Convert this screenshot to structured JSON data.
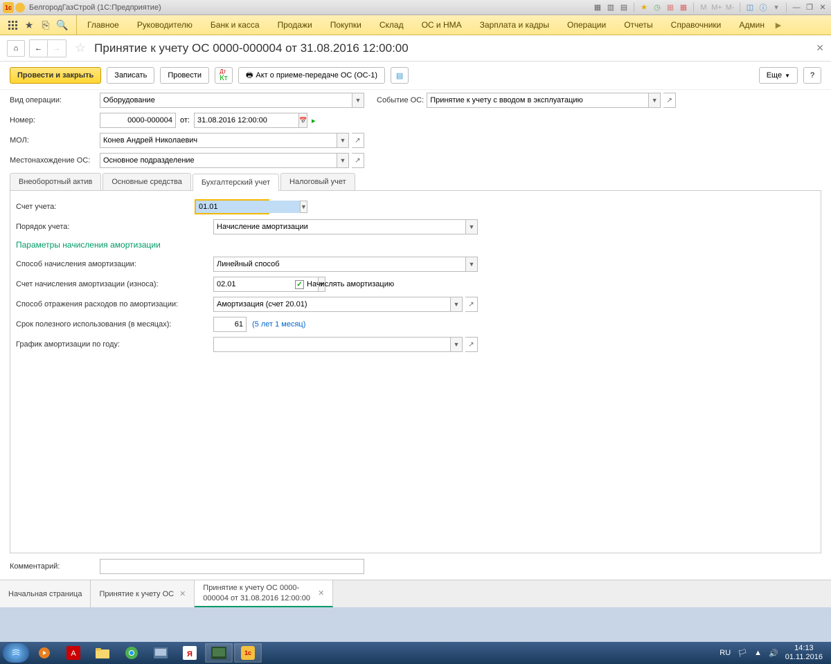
{
  "titlebar": {
    "app": "БелгородГазСтрой  (1С:Предприятие)",
    "memory": [
      "M",
      "M+",
      "M-"
    ]
  },
  "menu": {
    "items": [
      "Главное",
      "Руководителю",
      "Банк и касса",
      "Продажи",
      "Покупки",
      "Склад",
      "ОС и НМА",
      "Зарплата и кадры",
      "Операции",
      "Отчеты",
      "Справочники",
      "Админ"
    ]
  },
  "header": {
    "title": "Принятие к учету ОС 0000-000004 от 31.08.2016 12:00:00"
  },
  "toolbar": {
    "submit": "Провести и закрыть",
    "save": "Записать",
    "post": "Провести",
    "act": "Акт о приеме-передаче ОС (ОС-1)",
    "more": "Еще",
    "help": "?"
  },
  "form": {
    "op_type_lbl": "Вид операции:",
    "op_type": "Оборудование",
    "event_lbl": "Событие ОС:",
    "event": "Принятие к учету с вводом в эксплуатацию",
    "num_lbl": "Номер:",
    "num": "0000-000004",
    "from": "от:",
    "date": "31.08.2016 12:00:00",
    "mol_lbl": "МОЛ:",
    "mol": "Конев Андрей Николаевич",
    "loc_lbl": "Местонахождение ОС:",
    "loc": "Основное подразделение"
  },
  "tabs": [
    "Внеоборотный актив",
    "Основные средства",
    "Бухгалтерский учет",
    "Налоговый учет"
  ],
  "acct": {
    "account_lbl": "Счет учета:",
    "account": "01.01",
    "order_lbl": "Порядок учета:",
    "order": "Начисление амортизации",
    "section": "Параметры начисления амортизации",
    "method_lbl": "Способ начисления амортизации:",
    "method": "Линейный способ",
    "depr_acc_lbl": "Счет начисления амортизации (износа):",
    "depr_acc": "02.01",
    "depr_chk": "Начислять амортизацию",
    "refl_lbl": "Способ отражения расходов по амортизации:",
    "refl": "Амортизация (счет 20.01)",
    "useful_lbl": "Срок полезного использования (в месяцах):",
    "useful": "61",
    "useful_hint": "(5 лет 1 месяц)",
    "sched_lbl": "График амортизации по году:",
    "sched": ""
  },
  "comment_lbl": "Комментарий:",
  "comment": "",
  "btabs": [
    {
      "label": "Начальная страница",
      "close": false
    },
    {
      "label": "Принятие к учету ОС",
      "close": true
    },
    {
      "label": "Принятие к учету ОС 0000-000004 от 31.08.2016 12:00:00",
      "close": true,
      "active": true
    }
  ],
  "tray": {
    "lang": "RU",
    "time": "14:13",
    "date": "01.11.2016"
  }
}
